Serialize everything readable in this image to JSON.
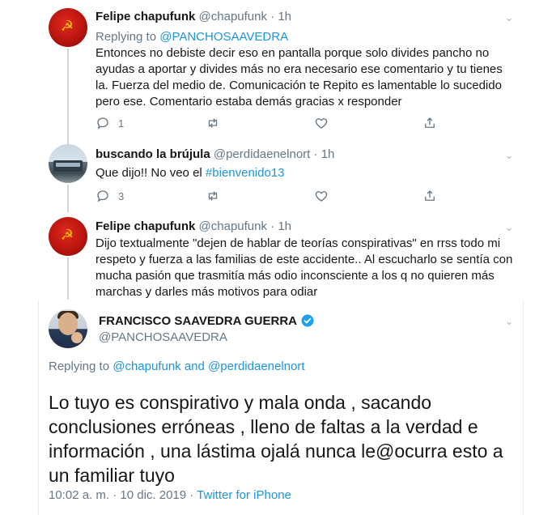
{
  "replies": [
    {
      "name": "Felipe chapufunk",
      "handle": "@chapufunk",
      "dot": "·",
      "time": "1h",
      "replying_prefix": "Replying to ",
      "replying_to": "@PANCHOSAAVEDRA",
      "text_lines": [
        "Entonces no debiste decir eso en pantalla porque solo divides pancho no",
        "ayudas a aportar y divides más no era necesario ese comentario y tu tienes",
        "la. Fuerza del medio de. Comunicación te Repito es lamentable lo sucedido",
        "pero ese. Comentario estaba demás gracias x responder"
      ],
      "reply_count": "1",
      "avatar": "hammer-sickle-red-avatar"
    },
    {
      "name": "buscando la brújula",
      "handle": "@perdidaenelnort",
      "dot": "·",
      "time": "1h",
      "text_prefix": "Que dijo!! No veo el ",
      "hashtag": "#bienvenido13",
      "reply_count": "3",
      "avatar": "bus-photo-avatar"
    },
    {
      "name": "Felipe chapufunk",
      "handle": "@chapufunk",
      "dot": "·",
      "time": "1h",
      "text_lines": [
        "Dijo  textualmente \"dejen de hablar de teorías conspirativas\" en rrss todo mi",
        "respeto y fuerza a las familias de este accidente.. Al escucharlo se sentía con",
        "mucha pasión que trasmitía más odio inconsciente a los q no quieren más",
        "marchas y darles más motivos para odiar"
      ],
      "avatar": "hammer-sickle-red-avatar"
    }
  ],
  "main_tweet": {
    "name": "FRANCISCO SAAVEDRA GUERRA",
    "handle": "@PANCHOSAAVEDRA",
    "verified": true,
    "replying_prefix": "Replying to ",
    "replying_to_1": "@chapufunk",
    "replying_and": " and ",
    "replying_to_2": "@perdidaenelnort",
    "text_lines": [
      "Lo tuyo es conspirativo y mala onda , sacando",
      "conclusiones erróneas , lleno de faltas a la verdad e",
      "información , una lástima ojalá nunca le@ocurra esto a",
      "un familiar tuyo"
    ],
    "time": "10:02 a. m. · 10 dic. 2019 · ",
    "source": "Twitter for iPhone"
  },
  "icons": {
    "reply": "reply-bubble-icon",
    "retweet": "retweet-icon",
    "like": "heart-icon",
    "share": "share-icon",
    "verified": "verified-badge-icon",
    "more": "chevron-down-icon"
  },
  "colors": {
    "link": "#1b95e0",
    "secondary_text": "#657786",
    "verified": "#1da1f2"
  }
}
